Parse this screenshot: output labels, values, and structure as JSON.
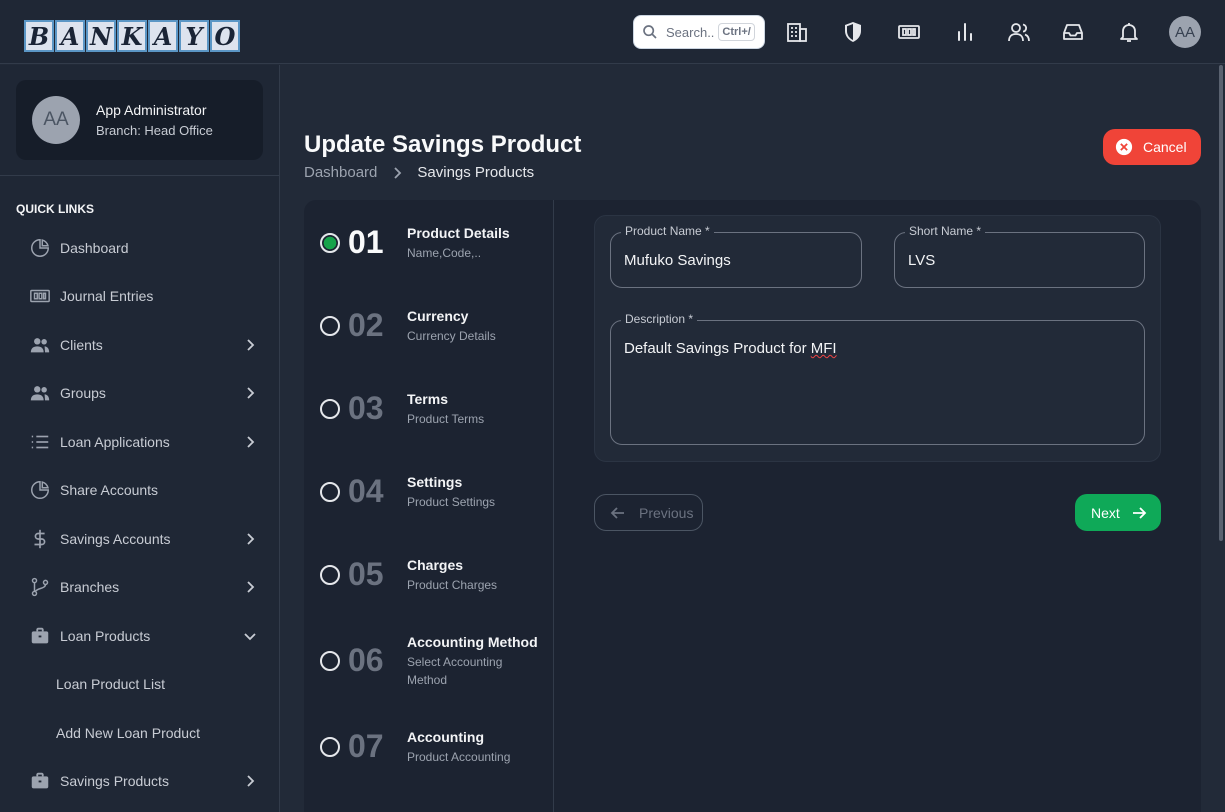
{
  "app": {
    "logo_letters": [
      "B",
      "A",
      "N",
      "K",
      "A",
      "Y",
      "O"
    ]
  },
  "topbar": {
    "search_placeholder": "Search..",
    "search_shortcut": "Ctrl+/",
    "icons": [
      "building-icon",
      "shield-icon",
      "money-icon",
      "chart-icon",
      "users-icon",
      "inbox-icon",
      "bell-icon"
    ],
    "avatar_initials": "AA"
  },
  "sidebar": {
    "user": {
      "initials": "AA",
      "name": "App Administrator",
      "branch": "Branch: Head Office"
    },
    "section_title": "QUICK LINKS",
    "items": [
      {
        "label": "Dashboard",
        "icon": "pie-chart-icon",
        "has_chevron": false
      },
      {
        "label": "Journal Entries",
        "icon": "money-icon",
        "has_chevron": false
      },
      {
        "label": "Clients",
        "icon": "users-icon",
        "has_chevron": true
      },
      {
        "label": "Groups",
        "icon": "users-icon",
        "has_chevron": true
      },
      {
        "label": "Loan Applications",
        "icon": "list-icon",
        "has_chevron": true
      },
      {
        "label": "Share Accounts",
        "icon": "pie-chart-icon",
        "has_chevron": false
      },
      {
        "label": "Savings Accounts",
        "icon": "dollar-icon",
        "has_chevron": true
      },
      {
        "label": "Branches",
        "icon": "git-branch-icon",
        "has_chevron": true
      },
      {
        "label": "Loan Products",
        "icon": "briefcase-icon",
        "has_chevron": "expanded"
      }
    ],
    "sub_items": [
      "Loan Product List",
      "Add New Loan Product"
    ],
    "last_item": {
      "label": "Savings Products",
      "icon": "briefcase-icon"
    }
  },
  "page": {
    "title": "Update Savings Product",
    "breadcrumb": [
      "Dashboard",
      "Savings Products"
    ],
    "cancel_label": "Cancel"
  },
  "steps": [
    {
      "num": "01",
      "title": "Product Details",
      "subtitle": "Name,Code,..",
      "active": true
    },
    {
      "num": "02",
      "title": "Currency",
      "subtitle": "Currency Details",
      "active": false
    },
    {
      "num": "03",
      "title": "Terms",
      "subtitle": "Product Terms",
      "active": false
    },
    {
      "num": "04",
      "title": "Settings",
      "subtitle": "Product Settings",
      "active": false
    },
    {
      "num": "05",
      "title": "Charges",
      "subtitle": "Product Charges",
      "active": false
    },
    {
      "num": "06",
      "title": "Accounting Method",
      "subtitle": "Select Accounting Method",
      "active": false
    },
    {
      "num": "07",
      "title": "Accounting",
      "subtitle": "Product Accounting",
      "active": false
    }
  ],
  "form": {
    "product_name_label": "Product Name *",
    "product_name_value": "Mufuko Savings",
    "short_name_label": "Short Name *",
    "short_name_value": "LVS",
    "description_label": "Description *",
    "description_value_prefix": "Default Savings Product for ",
    "description_value_flagged": "MFI",
    "previous_label": "Previous",
    "next_label": "Next"
  },
  "colors": {
    "accent_green": "#0fa958",
    "cancel_red": "#f04438",
    "background": "#222a38"
  }
}
